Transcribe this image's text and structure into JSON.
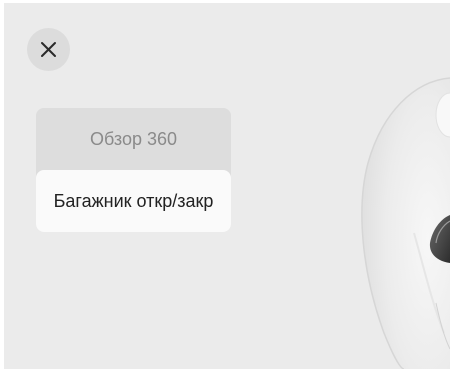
{
  "close_button": {
    "icon": "close-icon"
  },
  "view_menu": {
    "items": [
      {
        "label": "Обзор 360",
        "state": "inactive"
      },
      {
        "label": "Багажник откр/закр",
        "state": "active"
      }
    ]
  },
  "colors": {
    "background": "#ebebeb",
    "close_button_bg": "#dcdcdc",
    "menu_inactive_bg": "#dddddd",
    "menu_active_bg": "#fafafa",
    "inactive_text": "#8a8a8a",
    "active_text": "#222222"
  }
}
